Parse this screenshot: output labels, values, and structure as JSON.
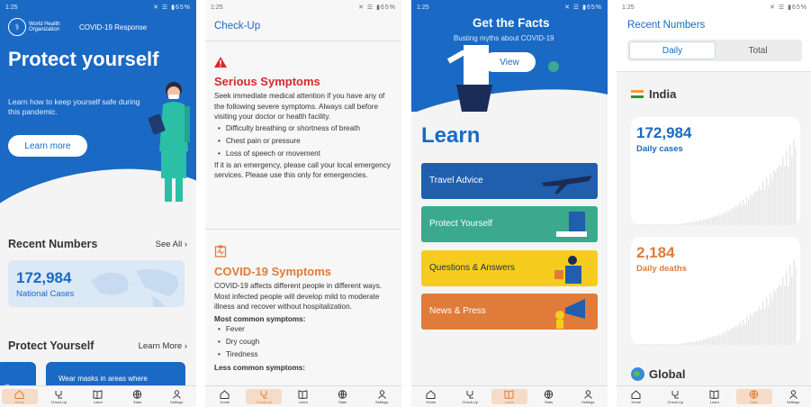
{
  "status": {
    "time": "1:25",
    "battery": "65%"
  },
  "nav": [
    "Home",
    "Check-Up",
    "Learn",
    "Stats",
    "Settings"
  ],
  "home": {
    "org": "World Health Organization",
    "response": "COVID-19 Response",
    "title": "Protect yourself",
    "subtitle": "Learn how to keep yourself safe during this pandemic.",
    "learn_more": "Learn more",
    "recent_numbers": "Recent Numbers",
    "see_all": "See All ›",
    "national_value": "172,984",
    "national_label": "National Cases",
    "protect_yourself": "Protect Yourself",
    "protect_link": "Learn More ›",
    "card_snippet": "Wear masks in areas where",
    "card_edge": "/3"
  },
  "checkup": {
    "header": "Check-Up",
    "serious_title": "Serious Symptoms",
    "serious_intro": "Seek immediate medical attention if you have any of the following severe symptoms. Always call before visiting your doctor or health facility.",
    "serious_items": [
      "Difficulty breathing or shortness of breath",
      "Chest pain or pressure",
      "Loss of speech or movement"
    ],
    "serious_note": "If it is an emergency, please call your local emergency services. Please use this only for emergencies.",
    "covid_title": "COVID-19 Symptoms",
    "covid_intro": "COVID-19 affects different people in different ways. Most infected people will develop mild to moderate illness and recover without hospitalization.",
    "common_label": "Most common symptoms:",
    "common_items": [
      "Fever",
      "Dry cough",
      "Tiredness"
    ],
    "less_common": "Less common symptoms:"
  },
  "learn": {
    "hero_title": "Get the Facts",
    "hero_sub": "Busting myths about COVID-19",
    "view": "View",
    "heading": "Learn",
    "cards": [
      {
        "label": "Travel Advice",
        "color": "#1f5fad"
      },
      {
        "label": "Protect Yourself",
        "color": "#3aa98e"
      },
      {
        "label": "Questions & Answers",
        "color": "#f6cd1f"
      },
      {
        "label": "News & Press",
        "color": "#e07b39"
      }
    ]
  },
  "stats": {
    "title": "Recent Numbers",
    "tab_daily": "Daily",
    "tab_total": "Total",
    "country": "India",
    "cases_value": "172,984",
    "cases_label": "Daily cases",
    "deaths_value": "2,184",
    "deaths_label": "Daily deaths",
    "global": "Global",
    "cases_color": "#1a69c4",
    "deaths_color": "#e07b39"
  }
}
